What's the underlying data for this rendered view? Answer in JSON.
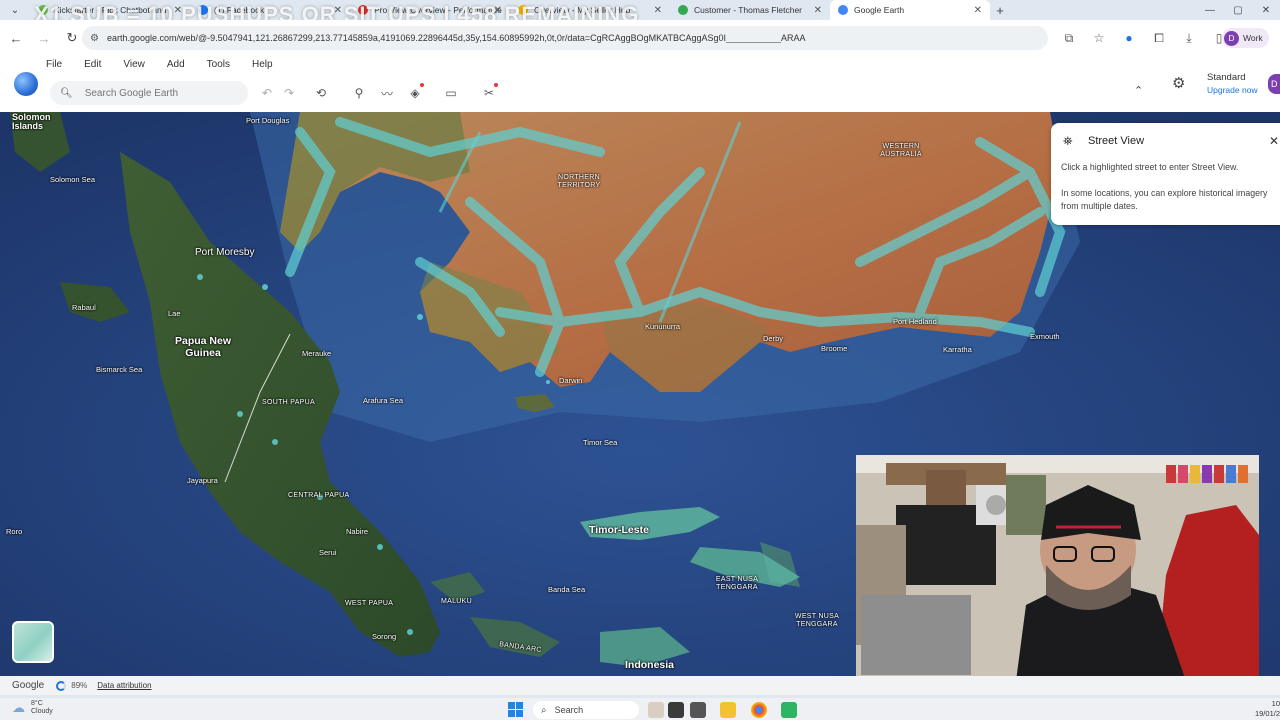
{
  "overlay": {
    "title": "X1 SUB = 10 PUSHUPS OR SIT UPS | 458 REMAINING"
  },
  "tabs": [
    {
      "label": "Kickstarter - Pick Chatbot and",
      "color": "#6cc24a"
    },
    {
      "label": "(1) Facebook",
      "color": "#1877f2"
    },
    {
      "label": "Pro View Overview - Performance",
      "color": "#d93025"
    },
    {
      "label": "Overview - My Seller Hub",
      "color": "#f6b400"
    },
    {
      "label": "Customer - Thomas Fletcher",
      "color": "#34a853"
    },
    {
      "label": "Google Earth",
      "color": "#4285f4",
      "active": true
    }
  ],
  "address": {
    "url": "earth.google.com/web/@-9.5047941,121.26867299,213.77145859a,4191069.22896445d,35y,154.60895992h,0t,0r/data=CgRCAggBOgMKATBCAggASg0I___________ARAA"
  },
  "profile": {
    "initial": "D",
    "label": "Work"
  },
  "menu": [
    "File",
    "Edit",
    "View",
    "Add",
    "Tools",
    "Help"
  ],
  "search": {
    "placeholder": "Search Google Earth"
  },
  "plan": {
    "tier": "Standard",
    "upgrade": "Upgrade now"
  },
  "street_view": {
    "title": "Street View",
    "p1": "Click a highlighted street to enter Street View.",
    "p2": "In some locations, you can explore historical imagery from multiple dates."
  },
  "map_labels": {
    "solomon_islands": "Solomon Islands",
    "port_douglas": "Port Douglas",
    "solomon_sea": "Solomon Sea",
    "port_moresby": "Port Moresby",
    "lae": "Lae",
    "rabaul": "Rabaul",
    "bismarck_sea": "Bismarck Sea",
    "png": "Papua New Guinea",
    "merauke": "Merauke",
    "south_papua": "SOUTH PAPUA",
    "arafura_sea": "Arafura Sea",
    "jayapura": "Jayapura",
    "central_papua": "CENTRAL PAPUA",
    "roro": "Roro",
    "nabire": "Nabire",
    "serui": "Serui",
    "west_papua": "WEST PAPUA",
    "sorong": "Sorong",
    "maluku": "MALUKU",
    "banda_sea": "Banda Sea",
    "banda_arc": "BANDA ARC",
    "indonesia": "Indonesia",
    "northern_territory": "NORTHERN TERRITORY",
    "kununurra": "Kununurra",
    "darwin": "Darwin",
    "timor_sea": "Timor Sea",
    "timor_leste": "Timor-Leste",
    "east_nusa_tenggara": "EAST NUSA TENGGARA",
    "west_nusa_tenggara": "WEST NUSA TENGGARA",
    "derby": "Derby",
    "broome": "Broome",
    "port_hedland": "Port Hedland",
    "karratha": "Karratha",
    "exmouth": "Exmouth",
    "western_australia": "WESTERN AUSTRALIA"
  },
  "attribution": {
    "google": "Google",
    "progress": "89%",
    "data_attribution": "Data attribution"
  },
  "taskbar": {
    "temp": "8°C",
    "condition": "Cloudy",
    "search": "Search",
    "time": "10",
    "date": "19/01/2"
  }
}
